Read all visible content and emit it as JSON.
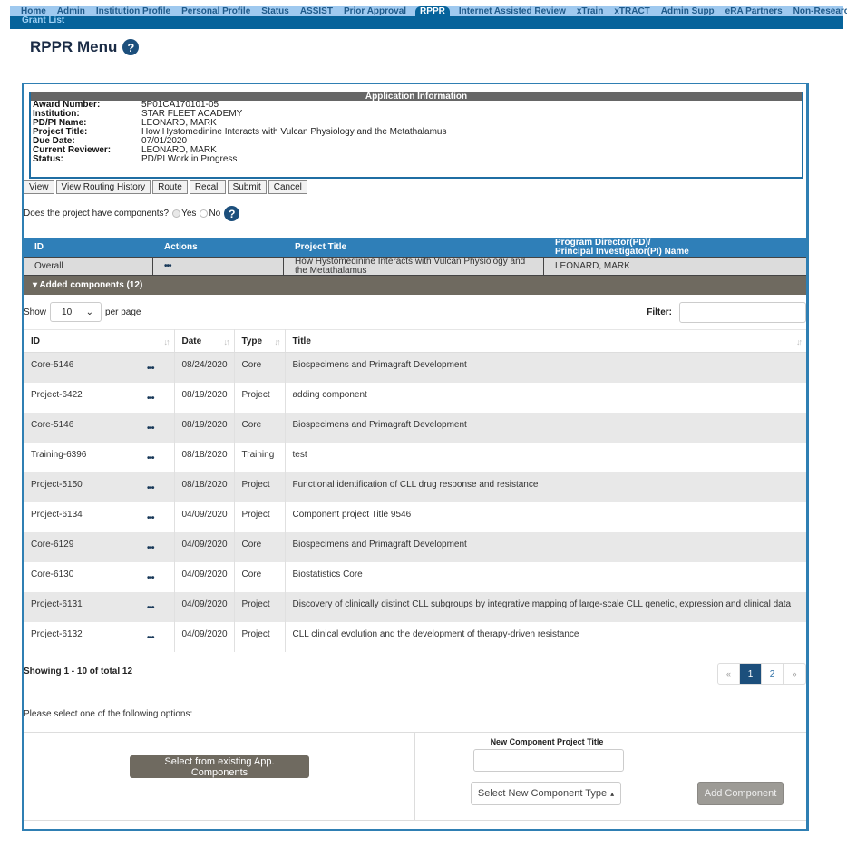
{
  "nav": {
    "tabs": [
      "Home",
      "Admin",
      "Institution Profile",
      "Personal Profile",
      "Status",
      "ASSIST",
      "Prior Approval",
      "RPPR",
      "Internet Assisted Review",
      "xTrain",
      "xTRACT",
      "Admin Supp",
      "eRA Partners",
      "Non-Research"
    ],
    "active_tab": "RPPR",
    "subnav_item": "Grant List"
  },
  "page": {
    "title": "RPPR Menu",
    "help_glyph": "?"
  },
  "app_info": {
    "heading": "Application Information",
    "rows": [
      {
        "label": "Award Number:",
        "value": "5P01CA170101-05"
      },
      {
        "label": "Institution:",
        "value": "STAR FLEET ACADEMY"
      },
      {
        "label": "PD/PI Name:",
        "value": "LEONARD, MARK"
      },
      {
        "label": "Project Title:",
        "value": "How Hystomedinine Interacts with Vulcan Physiology and the Metathalamus"
      },
      {
        "label": "Due Date:",
        "value": "07/01/2020"
      },
      {
        "label": "Current Reviewer:",
        "value": "LEONARD, MARK"
      },
      {
        "label": "Status:",
        "value": "PD/PI Work in Progress"
      }
    ]
  },
  "actions": {
    "view": "View",
    "view_routing_history": "View Routing History",
    "route": "Route",
    "recall": "Recall",
    "submit": "Submit",
    "cancel": "Cancel"
  },
  "components_question": {
    "text": "Does the project have components?",
    "yes": "Yes",
    "no": "No",
    "selected": "Yes"
  },
  "overall_table": {
    "headers": [
      "ID",
      "Actions",
      "Project Title",
      "Program Director(PD)/",
      "Principal Investigator(PI) Name"
    ],
    "row": {
      "id": "Overall",
      "actions": "•••",
      "title_line1": "How Hystomedinine Interacts with Vulcan Physiology and",
      "title_line2": "the Metathalamus",
      "pi": "LEONARD, MARK"
    }
  },
  "added_components": {
    "label": "▾ Added components (12)"
  },
  "list_controls": {
    "show_label": "Show",
    "per_page_value": "10",
    "per_page_label": "per page",
    "filter_label": "Filter:",
    "filter_value": ""
  },
  "components_table": {
    "headers": [
      "ID",
      "Date",
      "Type",
      "Title"
    ],
    "sort_glyph": "↓↑",
    "action_glyph": "•••",
    "rows": [
      {
        "id": "Core-5146",
        "date": "08/24/2020",
        "type": "Core",
        "title": "Biospecimens and Primagraft Development"
      },
      {
        "id": "Project-6422",
        "date": "08/19/2020",
        "type": "Project",
        "title": "adding component"
      },
      {
        "id": "Core-5146",
        "date": "08/19/2020",
        "type": "Core",
        "title": "Biospecimens and Primagraft Development"
      },
      {
        "id": "Training-6396",
        "date": "08/18/2020",
        "type": "Training",
        "title": "test"
      },
      {
        "id": "Project-5150",
        "date": "08/18/2020",
        "type": "Project",
        "title": "Functional identification of CLL drug response and resistance"
      },
      {
        "id": "Project-6134",
        "date": "04/09/2020",
        "type": "Project",
        "title": "Component project Title 9546"
      },
      {
        "id": "Core-6129",
        "date": "04/09/2020",
        "type": "Core",
        "title": "Biospecimens and Primagraft Development"
      },
      {
        "id": "Core-6130",
        "date": "04/09/2020",
        "type": "Core",
        "title": "Biostatistics Core"
      },
      {
        "id": "Project-6131",
        "date": "04/09/2020",
        "type": "Project",
        "title": "Discovery of clinically distinct CLL subgroups by integrative mapping of large-scale CLL genetic, expression and clinical data"
      },
      {
        "id": "Project-6132",
        "date": "04/09/2020",
        "type": "Project",
        "title": "CLL clinical evolution and the development of therapy-driven resistance"
      }
    ]
  },
  "pagination": {
    "summary": "Showing 1 - 10 of total 12",
    "prev": "«",
    "pages": [
      "1",
      "2"
    ],
    "current": "1",
    "next": "»"
  },
  "options": {
    "prompt": "Please select one of the following options:",
    "select_existing": "Select from existing App. Components",
    "new_title_label": "New Component Project Title",
    "new_title_value": "",
    "type_dropdown": "Select New Component Type",
    "type_caret": "▴",
    "add_button": "Add Component"
  }
}
